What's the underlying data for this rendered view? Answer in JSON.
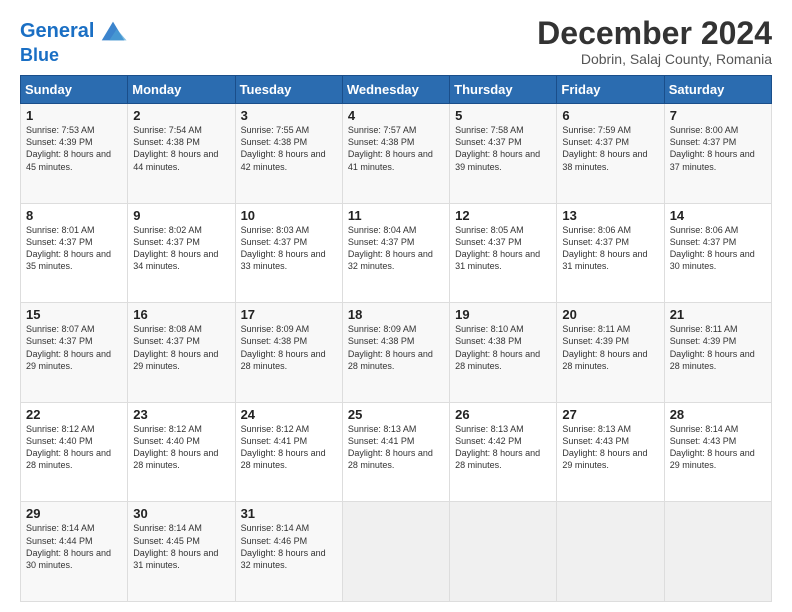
{
  "header": {
    "logo_line1": "General",
    "logo_line2": "Blue",
    "month": "December 2024",
    "location": "Dobrin, Salaj County, Romania"
  },
  "weekdays": [
    "Sunday",
    "Monday",
    "Tuesday",
    "Wednesday",
    "Thursday",
    "Friday",
    "Saturday"
  ],
  "weeks": [
    [
      {
        "day": "1",
        "sunrise": "Sunrise: 7:53 AM",
        "sunset": "Sunset: 4:39 PM",
        "daylight": "Daylight: 8 hours and 45 minutes."
      },
      {
        "day": "2",
        "sunrise": "Sunrise: 7:54 AM",
        "sunset": "Sunset: 4:38 PM",
        "daylight": "Daylight: 8 hours and 44 minutes."
      },
      {
        "day": "3",
        "sunrise": "Sunrise: 7:55 AM",
        "sunset": "Sunset: 4:38 PM",
        "daylight": "Daylight: 8 hours and 42 minutes."
      },
      {
        "day": "4",
        "sunrise": "Sunrise: 7:57 AM",
        "sunset": "Sunset: 4:38 PM",
        "daylight": "Daylight: 8 hours and 41 minutes."
      },
      {
        "day": "5",
        "sunrise": "Sunrise: 7:58 AM",
        "sunset": "Sunset: 4:37 PM",
        "daylight": "Daylight: 8 hours and 39 minutes."
      },
      {
        "day": "6",
        "sunrise": "Sunrise: 7:59 AM",
        "sunset": "Sunset: 4:37 PM",
        "daylight": "Daylight: 8 hours and 38 minutes."
      },
      {
        "day": "7",
        "sunrise": "Sunrise: 8:00 AM",
        "sunset": "Sunset: 4:37 PM",
        "daylight": "Daylight: 8 hours and 37 minutes."
      }
    ],
    [
      {
        "day": "8",
        "sunrise": "Sunrise: 8:01 AM",
        "sunset": "Sunset: 4:37 PM",
        "daylight": "Daylight: 8 hours and 35 minutes."
      },
      {
        "day": "9",
        "sunrise": "Sunrise: 8:02 AM",
        "sunset": "Sunset: 4:37 PM",
        "daylight": "Daylight: 8 hours and 34 minutes."
      },
      {
        "day": "10",
        "sunrise": "Sunrise: 8:03 AM",
        "sunset": "Sunset: 4:37 PM",
        "daylight": "Daylight: 8 hours and 33 minutes."
      },
      {
        "day": "11",
        "sunrise": "Sunrise: 8:04 AM",
        "sunset": "Sunset: 4:37 PM",
        "daylight": "Daylight: 8 hours and 32 minutes."
      },
      {
        "day": "12",
        "sunrise": "Sunrise: 8:05 AM",
        "sunset": "Sunset: 4:37 PM",
        "daylight": "Daylight: 8 hours and 31 minutes."
      },
      {
        "day": "13",
        "sunrise": "Sunrise: 8:06 AM",
        "sunset": "Sunset: 4:37 PM",
        "daylight": "Daylight: 8 hours and 31 minutes."
      },
      {
        "day": "14",
        "sunrise": "Sunrise: 8:06 AM",
        "sunset": "Sunset: 4:37 PM",
        "daylight": "Daylight: 8 hours and 30 minutes."
      }
    ],
    [
      {
        "day": "15",
        "sunrise": "Sunrise: 8:07 AM",
        "sunset": "Sunset: 4:37 PM",
        "daylight": "Daylight: 8 hours and 29 minutes."
      },
      {
        "day": "16",
        "sunrise": "Sunrise: 8:08 AM",
        "sunset": "Sunset: 4:37 PM",
        "daylight": "Daylight: 8 hours and 29 minutes."
      },
      {
        "day": "17",
        "sunrise": "Sunrise: 8:09 AM",
        "sunset": "Sunset: 4:38 PM",
        "daylight": "Daylight: 8 hours and 28 minutes."
      },
      {
        "day": "18",
        "sunrise": "Sunrise: 8:09 AM",
        "sunset": "Sunset: 4:38 PM",
        "daylight": "Daylight: 8 hours and 28 minutes."
      },
      {
        "day": "19",
        "sunrise": "Sunrise: 8:10 AM",
        "sunset": "Sunset: 4:38 PM",
        "daylight": "Daylight: 8 hours and 28 minutes."
      },
      {
        "day": "20",
        "sunrise": "Sunrise: 8:11 AM",
        "sunset": "Sunset: 4:39 PM",
        "daylight": "Daylight: 8 hours and 28 minutes."
      },
      {
        "day": "21",
        "sunrise": "Sunrise: 8:11 AM",
        "sunset": "Sunset: 4:39 PM",
        "daylight": "Daylight: 8 hours and 28 minutes."
      }
    ],
    [
      {
        "day": "22",
        "sunrise": "Sunrise: 8:12 AM",
        "sunset": "Sunset: 4:40 PM",
        "daylight": "Daylight: 8 hours and 28 minutes."
      },
      {
        "day": "23",
        "sunrise": "Sunrise: 8:12 AM",
        "sunset": "Sunset: 4:40 PM",
        "daylight": "Daylight: 8 hours and 28 minutes."
      },
      {
        "day": "24",
        "sunrise": "Sunrise: 8:12 AM",
        "sunset": "Sunset: 4:41 PM",
        "daylight": "Daylight: 8 hours and 28 minutes."
      },
      {
        "day": "25",
        "sunrise": "Sunrise: 8:13 AM",
        "sunset": "Sunset: 4:41 PM",
        "daylight": "Daylight: 8 hours and 28 minutes."
      },
      {
        "day": "26",
        "sunrise": "Sunrise: 8:13 AM",
        "sunset": "Sunset: 4:42 PM",
        "daylight": "Daylight: 8 hours and 28 minutes."
      },
      {
        "day": "27",
        "sunrise": "Sunrise: 8:13 AM",
        "sunset": "Sunset: 4:43 PM",
        "daylight": "Daylight: 8 hours and 29 minutes."
      },
      {
        "day": "28",
        "sunrise": "Sunrise: 8:14 AM",
        "sunset": "Sunset: 4:43 PM",
        "daylight": "Daylight: 8 hours and 29 minutes."
      }
    ],
    [
      {
        "day": "29",
        "sunrise": "Sunrise: 8:14 AM",
        "sunset": "Sunset: 4:44 PM",
        "daylight": "Daylight: 8 hours and 30 minutes."
      },
      {
        "day": "30",
        "sunrise": "Sunrise: 8:14 AM",
        "sunset": "Sunset: 4:45 PM",
        "daylight": "Daylight: 8 hours and 31 minutes."
      },
      {
        "day": "31",
        "sunrise": "Sunrise: 8:14 AM",
        "sunset": "Sunset: 4:46 PM",
        "daylight": "Daylight: 8 hours and 32 minutes."
      },
      null,
      null,
      null,
      null
    ]
  ]
}
